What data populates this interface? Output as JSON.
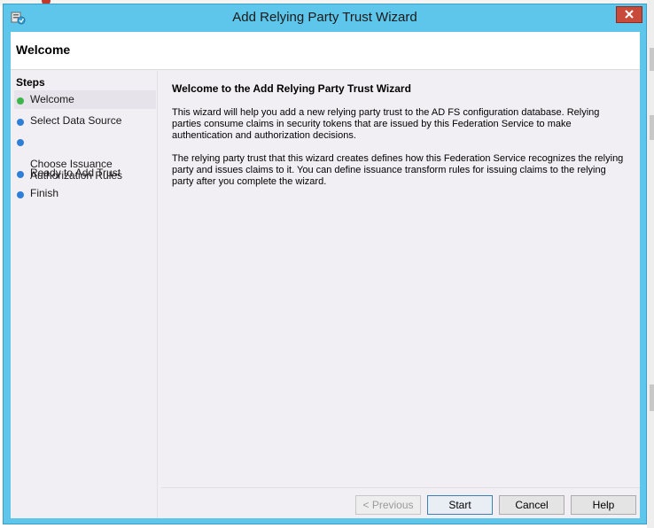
{
  "window": {
    "title": "Add Relying Party Trust Wizard",
    "title_bar_color": "#5dc6ea",
    "close_icon": "close-icon",
    "app_icon": "relying-party-icon"
  },
  "header": {
    "title": "Welcome"
  },
  "steps": {
    "title": "Steps",
    "items": [
      {
        "label": "Welcome",
        "status": "current",
        "dot_color": "#3cb54a"
      },
      {
        "label": "Select Data Source",
        "status": "pending",
        "dot_color": "#2f7fd8"
      },
      {
        "label": "Choose Issuance\nAuthorization Rules",
        "status": "pending",
        "dot_color": "#2f7fd8"
      },
      {
        "label": "Ready to Add Trust",
        "status": "pending",
        "dot_color": "#2f7fd8"
      },
      {
        "label": "Finish",
        "status": "pending",
        "dot_color": "#2f7fd8"
      }
    ]
  },
  "content": {
    "title": "Welcome to the Add Relying Party Trust Wizard",
    "paragraph1": "This wizard will help you add a new relying party trust to the AD FS configuration database.  Relying parties consume claims in security tokens that are issued by this Federation Service to make authentication and authorization decisions.",
    "paragraph2": "The relying party trust that this wizard creates defines how this Federation Service recognizes the relying party and issues claims to it. You can define issuance transform rules for issuing claims to the relying party after you complete the wizard."
  },
  "buttons": {
    "previous": "< Previous",
    "start": "Start",
    "cancel": "Cancel",
    "help": "Help"
  }
}
